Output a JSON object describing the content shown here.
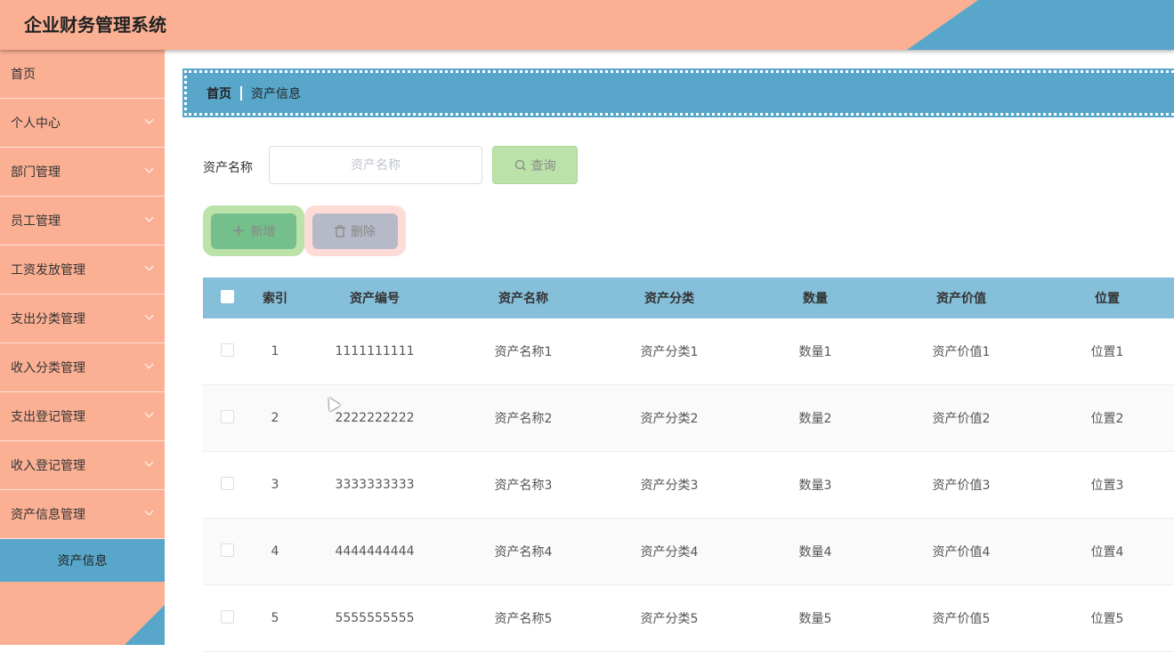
{
  "header": {
    "title": "企业财务管理系统"
  },
  "sidebar": {
    "items": [
      {
        "label": "首页",
        "expandable": false
      },
      {
        "label": "个人中心",
        "expandable": true
      },
      {
        "label": "部门管理",
        "expandable": true
      },
      {
        "label": "员工管理",
        "expandable": true
      },
      {
        "label": "工资发放管理",
        "expandable": true
      },
      {
        "label": "支出分类管理",
        "expandable": true
      },
      {
        "label": "收入分类管理",
        "expandable": true
      },
      {
        "label": "支出登记管理",
        "expandable": true
      },
      {
        "label": "收入登记管理",
        "expandable": true
      },
      {
        "label": "资产信息管理",
        "expandable": true
      }
    ],
    "active_sub": "资产信息"
  },
  "breadcrumb": {
    "home": "首页",
    "current": "资产信息"
  },
  "search": {
    "label": "资产名称",
    "placeholder": "资产名称",
    "value": "",
    "query_label": "查询"
  },
  "actions": {
    "add_label": "新增",
    "delete_label": "删除"
  },
  "table": {
    "columns": [
      "索引",
      "资产编号",
      "资产名称",
      "资产分类",
      "数量",
      "资产价值",
      "位置"
    ],
    "rows": [
      [
        "1",
        "1111111111",
        "资产名称1",
        "资产分类1",
        "数量1",
        "资产价值1",
        "位置1"
      ],
      [
        "2",
        "2222222222",
        "资产名称2",
        "资产分类2",
        "数量2",
        "资产价值2",
        "位置2"
      ],
      [
        "3",
        "3333333333",
        "资产名称3",
        "资产分类3",
        "数量3",
        "资产价值3",
        "位置3"
      ],
      [
        "4",
        "4444444444",
        "资产名称4",
        "资产分类4",
        "数量4",
        "资产价值4",
        "位置4"
      ],
      [
        "5",
        "5555555555",
        "资产名称5",
        "资产分类5",
        "数量5",
        "资产价值5",
        "位置5"
      ]
    ]
  },
  "colors": {
    "header": "#fbb094",
    "accent": "#58a7cb",
    "table_header": "#85bfd9"
  }
}
